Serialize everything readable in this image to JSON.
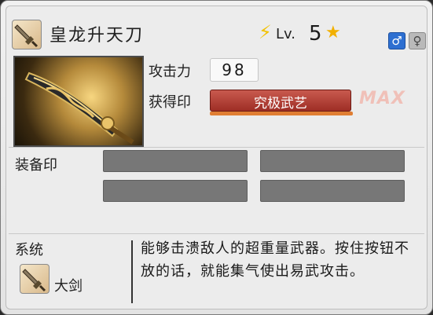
{
  "weapon": {
    "name": "皇龙升天刀",
    "level_prefix": "Lv.",
    "level": "5",
    "icon": "greatsword-icon"
  },
  "gender_icons": {
    "male": "♂",
    "female": "♀"
  },
  "stats": {
    "attack_label": "攻击力",
    "attack_value": "98",
    "seal_label": "获得印",
    "seal_value": "究极武艺",
    "max_label": "MAX"
  },
  "equip": {
    "label": "装备印"
  },
  "system": {
    "label": "系统",
    "type": "大剑",
    "description": "能够击溃敌人的超重量武器。按住按钮不放的话，就能集气使出易武攻击。"
  },
  "colors": {
    "seal": "#b1423a",
    "seal_bar": "#e07e33",
    "star": "#f2b000",
    "bolt": "#f2c200",
    "male": "#2d6fd1"
  }
}
